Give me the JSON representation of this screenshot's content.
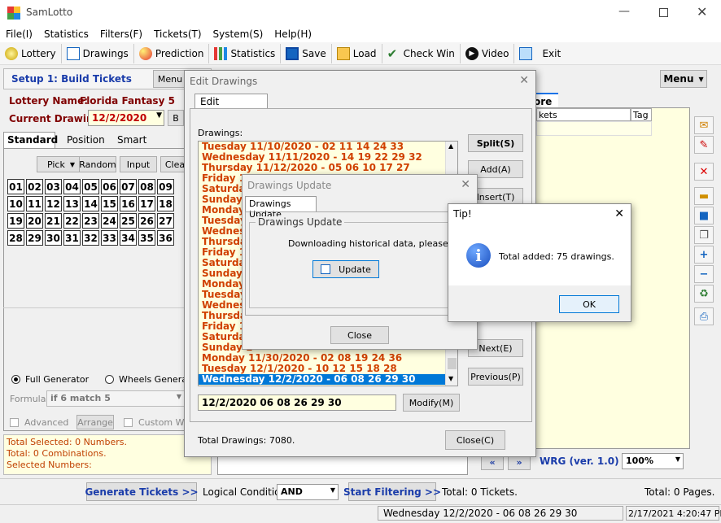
{
  "app": {
    "title": "SamLotto"
  },
  "menu": [
    "File(I)",
    "Statistics",
    "Filters(F)",
    "Tickets(T)",
    "System(S)",
    "Help(H)"
  ],
  "toolbar": [
    "Lottery",
    "Drawings",
    "Prediction",
    "Statistics",
    "Save",
    "Load",
    "Check Win",
    "Video",
    "Exit"
  ],
  "setup": {
    "label": "Setup 1: Build  Tickets",
    "menu_btn": "Menu",
    "lottery_label": "Lottery  Name:",
    "lottery_name": "Florida Fantasy 5",
    "current_label": "Current Drawing:",
    "current_value": "12/2/2020"
  },
  "tabs": {
    "standard": "Standard",
    "position": "Position",
    "smart": "Smart"
  },
  "pickrow": {
    "pick": "Pick",
    "random": "Random",
    "input": "Input",
    "clear": "Clea"
  },
  "numbers": [
    "01",
    "02",
    "03",
    "04",
    "05",
    "06",
    "07",
    "08",
    "09",
    "10",
    "11",
    "12",
    "13",
    "14",
    "15",
    "16",
    "17",
    "18",
    "19",
    "20",
    "21",
    "22",
    "23",
    "24",
    "25",
    "26",
    "27",
    "28",
    "29",
    "30",
    "31",
    "32",
    "33",
    "34",
    "35",
    "36"
  ],
  "generator": {
    "full": "Full Generator",
    "wheels": "Wheels Generato",
    "formula_label": "Formula:",
    "formula_value": "if 6 match 5",
    "advanced": "Advanced",
    "arrange": "Arrange",
    "custom": "Custom Wh"
  },
  "summary": {
    "selected": "Total Selected: 0 Numbers.",
    "combos": "Total: 0 Combinations.",
    "selnums": "Selected Numbers:"
  },
  "right": {
    "menu_btn": "Menu",
    "tab": "ore",
    "col_tickets": "kets",
    "col_tag": "Tag",
    "wrg": "WRG (ver. 1.0) :",
    "zoom": "100%"
  },
  "bottom": {
    "generate": "Generate Tickets >>",
    "logic_label": "Logical Condition:",
    "logic_value": "AND",
    "start_filter": "Start Filtering >>",
    "total_tickets": "Total: 0 Tickets.",
    "total_pages": "Total: 0 Pages."
  },
  "status": {
    "drawing": "Wednesday 12/2/2020 - 06 08 26 29 30",
    "datetime": "2/17/2021 4:20:47 PM"
  },
  "edit": {
    "title": "Edit Drawings",
    "tab": "Edit Drawings",
    "drawings_label": "Drawings:",
    "visible_full": [
      "Tuesday 11/10/2020 - 02 11 14 24 33",
      "Wednesday 11/11/2020 - 14 19 22 29 32",
      "Thursday 11/12/2020 - 05 06 10 17 27"
    ],
    "partial": [
      "Friday 11",
      "Saturday",
      "Sunday 1",
      "Monday",
      "Tuesday",
      "Wednesd",
      "Thursday",
      "Friday 11",
      "Saturday",
      "Sunday 1",
      "Monday 1",
      "Tuesday",
      "Wednesd",
      "Thursday",
      "Friday 11",
      "Saturday",
      "Sunday 1"
    ],
    "bottom_rows": [
      "Monday 11/30/2020 - 02 08 19 24 36",
      "Tuesday 12/1/2020 - 10 12 15 18 28"
    ],
    "selected_row": "Wednesday 12/2/2020 - 06 08 26 29 30",
    "split": "Split(S)",
    "add": "Add(A)",
    "insert": "Insert(T)",
    "next": "Next(E)",
    "previous": "Previous(P)",
    "input_value": "12/2/2020 06 08 26 29 30",
    "modify": "Modify(M)",
    "total": "Total Drawings: 7080.",
    "close": "Close(C)"
  },
  "update": {
    "title": "Drawings Update",
    "tab": "Drawings Update",
    "group": "Drawings Update",
    "msg": "Downloading historical data, please wait...",
    "btn": "Update",
    "close": "Close"
  },
  "tip": {
    "title": "Tip!",
    "msg": "Total added: 75 drawings.",
    "ok": "OK"
  }
}
